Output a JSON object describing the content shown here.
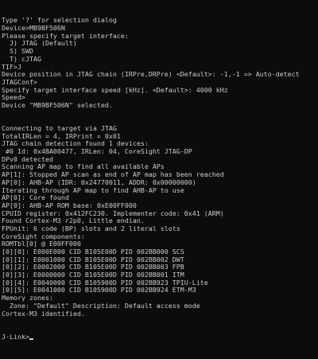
{
  "terminal": {
    "lines": [
      "Type '?' for selection dialog",
      "Device>MB9BF506N",
      "Please specify target interface:",
      "  J) JTAG (Default)",
      "  S) SWD",
      "  T) cJTAG",
      "TIF>J",
      "Device position in JTAG chain (IRPre,DRPre) <Default>: -1,-1 => Auto-detect",
      "JTAGConf>",
      "Specify target interface speed [kHz]. <Default>: 4000 kHz",
      "Speed>",
      "Device \"MB9BF506N\" selected.",
      "",
      "",
      "Connecting to target via JTAG",
      "TotalIRLen = 4, IRPrint = 0x01",
      "JTAG chain detection found 1 devices:",
      " #0 Id: 0x4BA00477, IRLen: 04, CoreSight JTAG-DP",
      "DPv0 detected",
      "Scanning AP map to find all available APs",
      "AP[1]: Stopped AP scan as end of AP map has been reached",
      "AP[0]: AHB-AP (IDR: 0x24770011, ADDR: 0x00000000)",
      "Iterating through AP map to find AHB-AP to use",
      "AP[0]: Core found",
      "AP[0]: AHB-AP ROM base: 0xE00FF000",
      "CPUID register: 0x412FC230. Implementer code: 0x41 (ARM)",
      "Found Cortex-M3 r2p0, Little endian.",
      "FPUnit: 6 code (BP) slots and 2 literal slots",
      "CoreSight components:",
      "ROMTbl[0] @ E00FF000",
      "[0][0]: E000E000 CID B105E00D PID 002BB000 SCS",
      "[0][1]: E0001000 CID B105E00D PID 002BB002 DWT",
      "[0][2]: E0002000 CID B105E00D PID 002BB003 FPB",
      "[0][3]: E0000000 CID B105E00D PID 002BB001 ITM",
      "[0][4]: E0040000 CID B105900D PID 002BB923 TPIU-Lite",
      "[0][5]: E0041000 CID B105900D PID 002BB924 ETM-M3",
      "Memory zones:",
      "  Zone: \"Default\" Description: Default access mode",
      "Cortex-M3 identified."
    ],
    "prompt": "J-Link>"
  },
  "colors": {
    "background": "#0c0c0c",
    "text": "#cccccc"
  }
}
